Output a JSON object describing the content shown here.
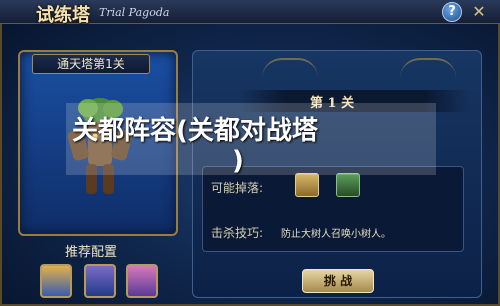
{
  "window": {
    "title_zh": "试练塔",
    "title_en": "Trial Pagoda",
    "help_icon": "?",
    "close_icon": "✕"
  },
  "left_panel": {
    "header": "通天塔第1关",
    "recommend_label": "推荐配置",
    "heroes": [
      "hero-1",
      "hero-2",
      "hero-3"
    ]
  },
  "right_panel": {
    "stage_label": "第 1 关",
    "drop_label": "可能掉落:",
    "skill_label": "击杀技巧:",
    "skill_text": "防止大树人召唤小树人。",
    "challenge_button": "挑 战"
  },
  "watermark": {
    "line1": "关都阵容(关都对战塔",
    "line2": ")"
  },
  "colors": {
    "accent_gold": "#9a7c3e",
    "panel_blue": "#1a4fa3",
    "button_gold": "#e6d6a6"
  }
}
